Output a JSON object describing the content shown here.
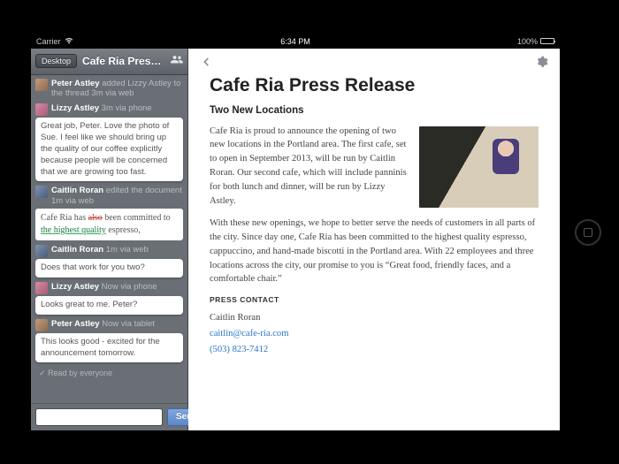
{
  "status": {
    "carrier": "Carrier",
    "time": "6:34 PM",
    "battery": "100%"
  },
  "sidebar": {
    "desktop_label": "Desktop",
    "doc_title": "Cafe Ria Press…",
    "thread": [
      {
        "name": "Peter Astley",
        "meta": " added Lizzy Astley to the thread 3m via web"
      },
      {
        "name": "Lizzy Astley",
        "meta": " 3m via phone",
        "bubble": "Great job, Peter. Love the photo of Sue. I feel like we should bring up the quality of our coffee explicitly because people will be concerned that we are growing too fast."
      },
      {
        "name": "Caitlin Roran",
        "meta": " edited the document 1m via web",
        "diff_pre": "Cafe Ria has ",
        "diff_del": "also",
        "diff_mid": " been committed to ",
        "diff_ins": "the highest quality",
        "diff_post": " espresso,"
      },
      {
        "name": "Caitlin Roran",
        "meta": " 1m via web",
        "bubble": "Does that work for you two?"
      },
      {
        "name": "Lizzy Astley",
        "meta": " Now via phone",
        "bubble": "Looks great to me. Peter?"
      },
      {
        "name": "Peter Astley",
        "meta": " Now via tablet",
        "bubble": "This looks good - excited for the announcement tomorrow."
      }
    ],
    "read_by": "Read by everyone",
    "send_label": "Send",
    "compose_placeholder": ""
  },
  "document": {
    "title": "Cafe Ria Press Release",
    "subtitle": "Two New Locations",
    "p1": "Cafe Ria is proud to announce the opening of two new locations in the Portland area. The first cafe, set to open in September 2013, will be run by Caitlin Roran. Our second cafe, which will include panninis for both lunch and dinner, will be run by Lizzy Astley.",
    "p2": "With these new openings, we hope to better serve the needs of customers in all parts of the city. Since day one, Cafe Ria has been committed to the highest quality espresso, cappuccino, and hand-made biscotti in the Portland area. With 22 employees and three locations across the city, our promise to you is “Great food, friendly faces, and a comfortable chair.”",
    "contact_label": "PRESS CONTACT",
    "contact_name": "Caitlin Roran",
    "contact_email": "caitlin@cafe-ria.com",
    "contact_phone": "(503) 823-7412"
  }
}
